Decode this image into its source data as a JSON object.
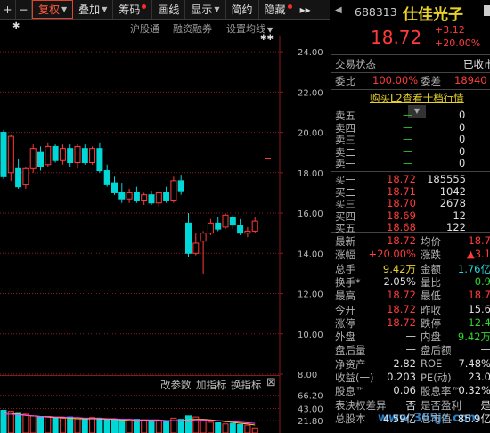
{
  "toolbar": {
    "plus": "+",
    "minus": "−",
    "fuquan": "复权",
    "diejia": "叠加",
    "chouma": "筹码",
    "huaxian": "画线",
    "xianshi": "显示",
    "jianyue": "简约",
    "yincang": "隐藏",
    "more": "▸▸"
  },
  "subbar": {
    "hugutong": "沪股通",
    "rongzi": "融资融券",
    "settings": "设置均线",
    "star": "✱",
    "star2": "✱✱"
  },
  "axis": {
    "price_ticks": [
      "24.00",
      "22.00",
      "20.00",
      "18.00",
      "16.00",
      "14.00",
      "12.00",
      "10.00",
      "8.00"
    ],
    "vol_ticks": [
      "66.20",
      "43.00",
      "21.80"
    ]
  },
  "indicator_bar": {
    "change_params": "改参数",
    "add_indicator": "加指标",
    "switch_indicator": "换指标",
    "close": "⊠"
  },
  "quote": {
    "code": "688313",
    "name": "仕佳光子",
    "price": "18.72",
    "change": "+3.12",
    "change_pct": "+20.00%",
    "status_label": "交易状态",
    "status_value": "已收市",
    "webi_label": "委比",
    "webi_value": "100.00%",
    "weicha_label": "委差",
    "weicha_value": "18940",
    "l2_link": "购买L2查看十档行情",
    "asks": [
      {
        "label": "卖五",
        "price": "—",
        "vol": "0"
      },
      {
        "label": "卖四",
        "price": "—",
        "vol": "0"
      },
      {
        "label": "卖三",
        "price": "—",
        "vol": "0"
      },
      {
        "label": "卖二",
        "price": "—",
        "vol": "0"
      },
      {
        "label": "卖一",
        "price": "—",
        "vol": "0"
      }
    ],
    "bids": [
      {
        "label": "买一",
        "price": "18.72",
        "vol": "185555"
      },
      {
        "label": "买二",
        "price": "18.71",
        "vol": "1042"
      },
      {
        "label": "买三",
        "price": "18.70",
        "vol": "2678"
      },
      {
        "label": "买四",
        "price": "18.69",
        "vol": "12"
      },
      {
        "label": "买五",
        "price": "18.68",
        "vol": "122"
      }
    ],
    "stats": [
      {
        "l1": "最新",
        "v1": "18.72",
        "c1": "red",
        "l2": "均价",
        "v2": "18.7",
        "c2": "red"
      },
      {
        "l1": "涨幅",
        "v1": "+20.00%",
        "c1": "red",
        "l2": "涨跌",
        "v2": "▲3.1",
        "c2": "red"
      },
      {
        "l1": "总手",
        "v1": "9.42万",
        "c1": "yel",
        "l2": "金额",
        "v2": "1.76亿",
        "c2": "cyan"
      },
      {
        "l1": "换手*",
        "v1": "2.05%",
        "c1": "wht",
        "l2": "量比",
        "v2": "0.9",
        "c2": "green"
      },
      {
        "l1": "最高",
        "v1": "18.72",
        "c1": "red",
        "l2": "最低",
        "v2": "18.7",
        "c2": "red"
      },
      {
        "l1": "今开",
        "v1": "18.72",
        "c1": "red",
        "l2": "昨收",
        "v2": "15.6",
        "c2": "wht"
      },
      {
        "l1": "涨停",
        "v1": "18.72",
        "c1": "red",
        "l2": "跌停",
        "v2": "12.4",
        "c2": "green"
      },
      {
        "l1": "外盘",
        "v1": "—",
        "c1": "wht",
        "l2": "内盘",
        "v2": "9.42万",
        "c2": "green"
      },
      {
        "l1": "盘后量",
        "v1": "—",
        "c1": "wht",
        "l2": "盘后额",
        "v2": "—",
        "c2": "wht"
      },
      {
        "l1": "净资产",
        "v1": "2.82",
        "c1": "wht",
        "l2": "ROE",
        "v2": "7.48%",
        "c2": "wht"
      },
      {
        "l1": "收益(一)",
        "v1": "0.203",
        "c1": "wht",
        "l2": "PE(动)",
        "v2": "23.0",
        "c2": "wht"
      },
      {
        "l1": "股息™",
        "v1": "0.06",
        "c1": "wht",
        "l2": "股息率™",
        "v2": "0.32%",
        "c2": "wht"
      },
      {
        "l1": "表决权差异",
        "v1": "否",
        "c1": "wht",
        "l2": "是否盈利",
        "v2": "是",
        "c2": "wht"
      },
      {
        "l1": "总股本",
        "v1": "4.59亿",
        "c1": "wht",
        "l2": "总市值",
        "v2": "85.9亿",
        "c2": "wht"
      }
    ]
  },
  "watermark": "www.365jz.com",
  "colors": {
    "up": "#ff3b3b",
    "down": "#00d8d8",
    "ma5": "#ffffff",
    "ma10": "#e8d22a",
    "ma20": "#ff44ff",
    "grid": "#8a1a1a"
  },
  "chart_data": {
    "type": "candlestick",
    "ylim": [
      8,
      24.8
    ],
    "candles": [
      {
        "o": 20.0,
        "h": 20.1,
        "l": 17.7,
        "c": 17.8
      },
      {
        "o": 18.0,
        "h": 19.9,
        "l": 17.6,
        "c": 19.8
      },
      {
        "o": 18.2,
        "h": 18.7,
        "l": 17.2,
        "c": 17.3
      },
      {
        "o": 17.4,
        "h": 18.3,
        "l": 17.2,
        "c": 18.2
      },
      {
        "o": 18.2,
        "h": 19.4,
        "l": 18.0,
        "c": 19.2
      },
      {
        "o": 19.0,
        "h": 19.3,
        "l": 18.1,
        "c": 18.3
      },
      {
        "o": 18.4,
        "h": 19.5,
        "l": 18.3,
        "c": 19.3
      },
      {
        "o": 19.3,
        "h": 19.4,
        "l": 18.5,
        "c": 18.6
      },
      {
        "o": 18.6,
        "h": 19.4,
        "l": 18.4,
        "c": 19.2
      },
      {
        "o": 19.2,
        "h": 19.4,
        "l": 18.3,
        "c": 18.5
      },
      {
        "o": 18.5,
        "h": 19.4,
        "l": 18.2,
        "c": 19.3
      },
      {
        "o": 19.2,
        "h": 19.4,
        "l": 18.4,
        "c": 18.5
      },
      {
        "o": 18.5,
        "h": 19.3,
        "l": 18.4,
        "c": 19.2
      },
      {
        "o": 19.2,
        "h": 19.5,
        "l": 18.0,
        "c": 18.1
      },
      {
        "o": 18.1,
        "h": 18.4,
        "l": 17.3,
        "c": 17.4
      },
      {
        "o": 17.5,
        "h": 17.8,
        "l": 16.9,
        "c": 17.0
      },
      {
        "o": 17.0,
        "h": 17.5,
        "l": 16.5,
        "c": 16.7
      },
      {
        "o": 16.7,
        "h": 17.2,
        "l": 16.5,
        "c": 17.0
      },
      {
        "o": 17.0,
        "h": 17.3,
        "l": 16.5,
        "c": 16.6
      },
      {
        "o": 16.6,
        "h": 17.0,
        "l": 16.4,
        "c": 16.9
      },
      {
        "o": 16.9,
        "h": 17.1,
        "l": 16.4,
        "c": 16.5
      },
      {
        "o": 16.5,
        "h": 17.1,
        "l": 16.3,
        "c": 17.0
      },
      {
        "o": 17.0,
        "h": 17.3,
        "l": 16.5,
        "c": 16.6
      },
      {
        "o": 16.6,
        "h": 17.8,
        "l": 16.5,
        "c": 17.6
      },
      {
        "o": 17.6,
        "h": 17.9,
        "l": 16.9,
        "c": 17.1
      },
      {
        "o": 15.5,
        "h": 16.0,
        "l": 13.8,
        "c": 14.0
      },
      {
        "o": 14.0,
        "h": 15.0,
        "l": 13.9,
        "c": 14.5
      },
      {
        "o": 14.6,
        "h": 15.1,
        "l": 13.0,
        "c": 15.0
      },
      {
        "o": 15.0,
        "h": 15.7,
        "l": 14.9,
        "c": 15.5
      },
      {
        "o": 15.5,
        "h": 15.8,
        "l": 15.1,
        "c": 15.2
      },
      {
        "o": 15.3,
        "h": 16.0,
        "l": 15.2,
        "c": 15.9
      },
      {
        "o": 15.8,
        "h": 15.9,
        "l": 15.2,
        "c": 15.4
      },
      {
        "o": 15.4,
        "h": 15.7,
        "l": 14.9,
        "c": 15.0
      },
      {
        "o": 15.0,
        "h": 15.3,
        "l": 14.8,
        "c": 15.1
      },
      {
        "o": 15.1,
        "h": 15.8,
        "l": 15.0,
        "c": 15.6
      }
    ],
    "limit_marker": 18.72,
    "volume": {
      "ylim": [
        0,
        72
      ],
      "values": [
        40,
        38,
        36,
        33,
        30,
        28,
        29,
        27,
        26,
        28,
        25,
        24,
        27,
        26,
        25,
        23,
        22,
        21,
        24,
        23,
        22,
        21,
        20,
        26,
        24,
        30,
        28,
        22,
        19,
        18,
        16,
        17,
        15,
        14,
        9
      ],
      "ma_lines": [
        [
          36,
          35,
          33,
          31,
          30,
          29,
          28,
          27,
          27,
          26,
          25,
          25,
          25,
          25,
          24,
          24,
          23,
          22,
          22,
          22,
          22,
          22,
          21,
          22,
          22,
          23,
          24,
          24,
          23,
          22,
          20,
          19,
          17,
          16,
          14
        ],
        [
          33,
          33,
          32,
          31,
          30,
          29,
          29,
          28,
          28,
          27,
          27,
          26,
          26,
          26,
          25,
          25,
          24,
          24,
          23,
          23,
          23,
          23,
          22,
          22,
          22,
          22,
          23,
          23,
          22,
          22,
          21,
          20,
          19,
          18,
          17
        ]
      ]
    }
  }
}
